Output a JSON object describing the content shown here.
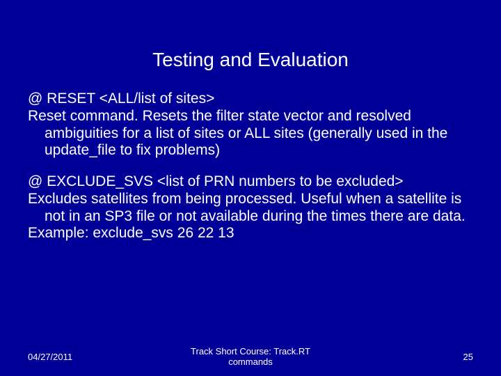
{
  "title": "Testing and Evaluation",
  "block1": {
    "cmd": "@ RESET <ALL/list of sites>",
    "desc": "Reset command.  Resets the filter state vector and resolved ambiguities for a list of sites or ALL sites (generally used in the update_file to fix problems)"
  },
  "block2": {
    "cmd": "@ EXCLUDE_SVS <list of PRN numbers to be excluded>",
    "desc": "Excludes satellites from being processed.  Useful when a satellite is not in an SP3 file or not available during the times there are data.",
    "example": "Example: exclude_svs 26 22 13"
  },
  "footer": {
    "date": "04/27/2011",
    "center1": "Track Short Course: Track.RT",
    "center2": "commands",
    "page": "25"
  }
}
